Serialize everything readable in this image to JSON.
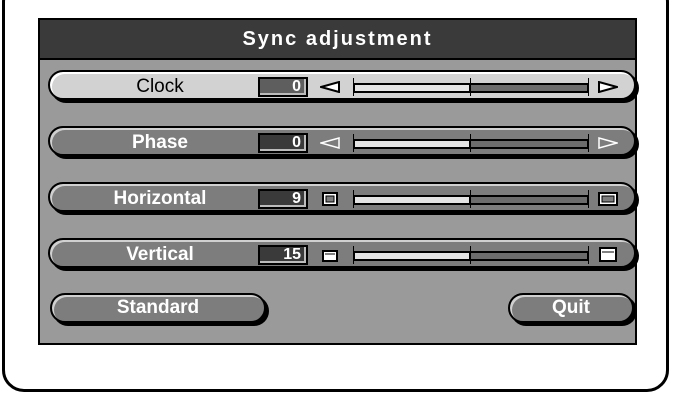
{
  "title": "Sync adjustment",
  "rows": [
    {
      "label": "Clock",
      "value": "0",
      "left_icon": "triangle-left-icon",
      "right_icon": "triangle-right-icon",
      "active": true
    },
    {
      "label": "Phase",
      "value": "0",
      "left_icon": "triangle-left-icon",
      "right_icon": "triangle-right-icon",
      "active": false
    },
    {
      "label": "Horizontal",
      "value": "9",
      "left_icon": "narrow-window-icon",
      "right_icon": "wide-window-icon",
      "active": false
    },
    {
      "label": "Vertical",
      "value": "15",
      "left_icon": "short-window-icon",
      "right_icon": "tall-window-icon",
      "active": false
    }
  ],
  "slider_level": 0.5,
  "buttons": {
    "standard": "Standard",
    "quit": "Quit"
  },
  "colors": {
    "panel": "#9a9a9a",
    "title_bar": "#3a3a3a",
    "selected_row": "#d2d2d2",
    "row": "#7d7d7d"
  }
}
